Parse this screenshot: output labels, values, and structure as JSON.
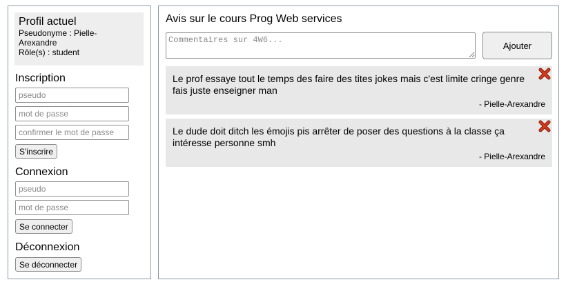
{
  "profile": {
    "title": "Profil actuel",
    "pseudonym_line_1": "Pseudonyme : Pielle-",
    "pseudonym_line_2": "Arexandre",
    "roles": "Rôle(s) : student"
  },
  "signup": {
    "title": "Inscription",
    "pseudo_placeholder": "pseudo",
    "password_placeholder": "mot de passe",
    "confirm_placeholder": "confirmer le mot de passe",
    "button": "S'inscrire"
  },
  "login": {
    "title": "Connexion",
    "pseudo_placeholder": "pseudo",
    "password_placeholder": "mot de passe",
    "button": "Se connecter"
  },
  "logout": {
    "title": "Déconnexion",
    "button": "Se déconnecter"
  },
  "course": {
    "title": "Avis sur le cours Prog Web services",
    "comment_placeholder": "Commentaires sur 4W6...",
    "add_button": "Ajouter"
  },
  "comments": [
    {
      "text": "Le prof essaye tout le temps des faire des tites jokes mais c'est limite cringe genre fais juste enseigner man",
      "author": "- Pielle-Arexandre"
    },
    {
      "text": "Le dude doit ditch les émojis pis arrêter de poser des questions à la classe ça intéresse personne smh",
      "author": "- Pielle-Arexandre"
    }
  ],
  "colors": {
    "delete_icon": "#d9391c",
    "comment_bg": "#e8e8e8",
    "profile_bg": "#eeeeee"
  }
}
